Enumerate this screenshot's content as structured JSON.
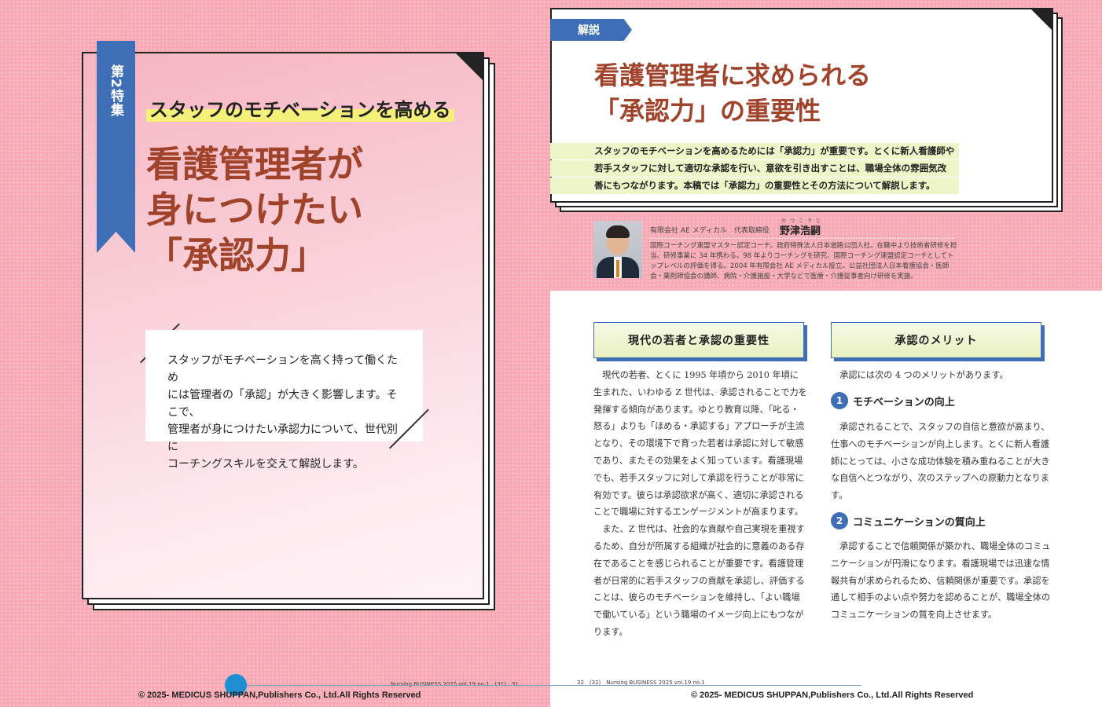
{
  "left": {
    "ribbon": "第2特集",
    "subtitle": "スタッフのモチベーションを高める",
    "title_lines": [
      "看護管理者が",
      "身につけたい",
      "「承認力」"
    ],
    "lead_lines": [
      "スタッフがモチベーションを高く持って働くため",
      "には管理者の「承認」が大きく影響します。そこで、",
      "管理者が身につけたい承認力について、世代別に",
      "コーチングスキルを交えて解説します。"
    ],
    "folio": "Nursing BUSINESS 2025 vol.19 no.1　(31)　31",
    "copyright": "© 2025- MEDICUS SHUPPAN,Publishers Co., Ltd.All Rights Reserved"
  },
  "right": {
    "tag": "解説",
    "title_lines": [
      "看護管理者に求められる",
      "「承認力」の重要性"
    ],
    "lead_lines": [
      "スタッフのモチベーションを高めるためには「承認力」が重要です。とくに新人看護師や",
      "若手スタッフに対して適切な承認を行い、意欲を引き出すことは、職場全体の雰囲気改",
      "善にもつながります。本稿では「承認力」の重要性とその方法について解説します。"
    ],
    "author": {
      "affiliation": "有限会社 AE メディカル　代表取締役",
      "name": "野津浩嗣",
      "ruby": "のつこうじ",
      "bio": "国際コーチング連盟マスター認定コーチ。政府特殊法人日本道路公団入社。在職中より技術者研修を担当、研修事業に 34 年携わる。98 年よりコーチングを研究、国際コーチング連盟認定コーチとしてトップレベルの評価を得る。2004 年有限会社 AE メディカル設立。公益社団法人日本看護協会・医師会・薬剤師協会の講師、病院・介護施設・大学などで医療・介護従事者向け研修を実施。"
    },
    "section1": {
      "heading": "現代の若者と承認の重要性",
      "paragraphs": [
        "現代の若者、とくに 1995 年頃から 2010 年頃に生まれた、いわゆる Z 世代は、承認されることで力を発揮する傾向があります。ゆとり教育以降、「叱る・怒る」よりも「ほめる・承認する」アプローチが主流となり、その環境下で育った若者は承認に対して敏感であり、またその効果をよく知っています。看護現場でも、若手スタッフに対して承認を行うことが非常に有効です。彼らは承認欲求が高く、適切に承認されることで職場に対するエンゲージメントが高まります。",
        "また、Z 世代は、社会的な貢献や自己実現を重視するため、自分が所属する組織が社会的に意義のある存在であることを感じられることが重要です。看護管理者が日常的に若手スタッフの貢献を承認し、評価することは、彼らのモチベーションを維持し、「よい職場で働いている」という職場のイメージ向上にもつながります。"
      ]
    },
    "section2": {
      "heading": "承認のメリット",
      "intro": "承認には次の 4 つのメリットがあります。",
      "merits": [
        {
          "num": "1",
          "title": "モチベーションの向上",
          "body": "承認されることで、スタッフの自信と意欲が高まり、仕事へのモチベーションが向上します。とくに新人看護師にとっては、小さな成功体験を積み重ねることが大きな自信へとつながり、次のステップへの原動力となります。"
        },
        {
          "num": "2",
          "title": "コミュニケーションの質向上",
          "body": "承認することで信頼関係が築かれ、職場全体のコミュニケーションが円滑になります。看護現場では迅速な情報共有が求められるため、信頼関係が重要です。承認を通して相手のよい点や努力を認めることが、職場全体のコミュニケーションの質を向上させます。"
        }
      ]
    },
    "folio": "32　(32)　Nursing BUSINESS 2025 vol.19 no.1",
    "copyright": "© 2025- MEDICUS SHUPPAN,Publishers Co., Ltd.All Rights Reserved"
  },
  "colors": {
    "pink_bg": "#f7aab5",
    "accent_blue": "#3e6fb6",
    "title_brown": "#a0432a",
    "highlight_green": "#eef5c8",
    "subtitle_yellow": "#f5f07a",
    "scrubber_blue": "#1e8fd2"
  }
}
